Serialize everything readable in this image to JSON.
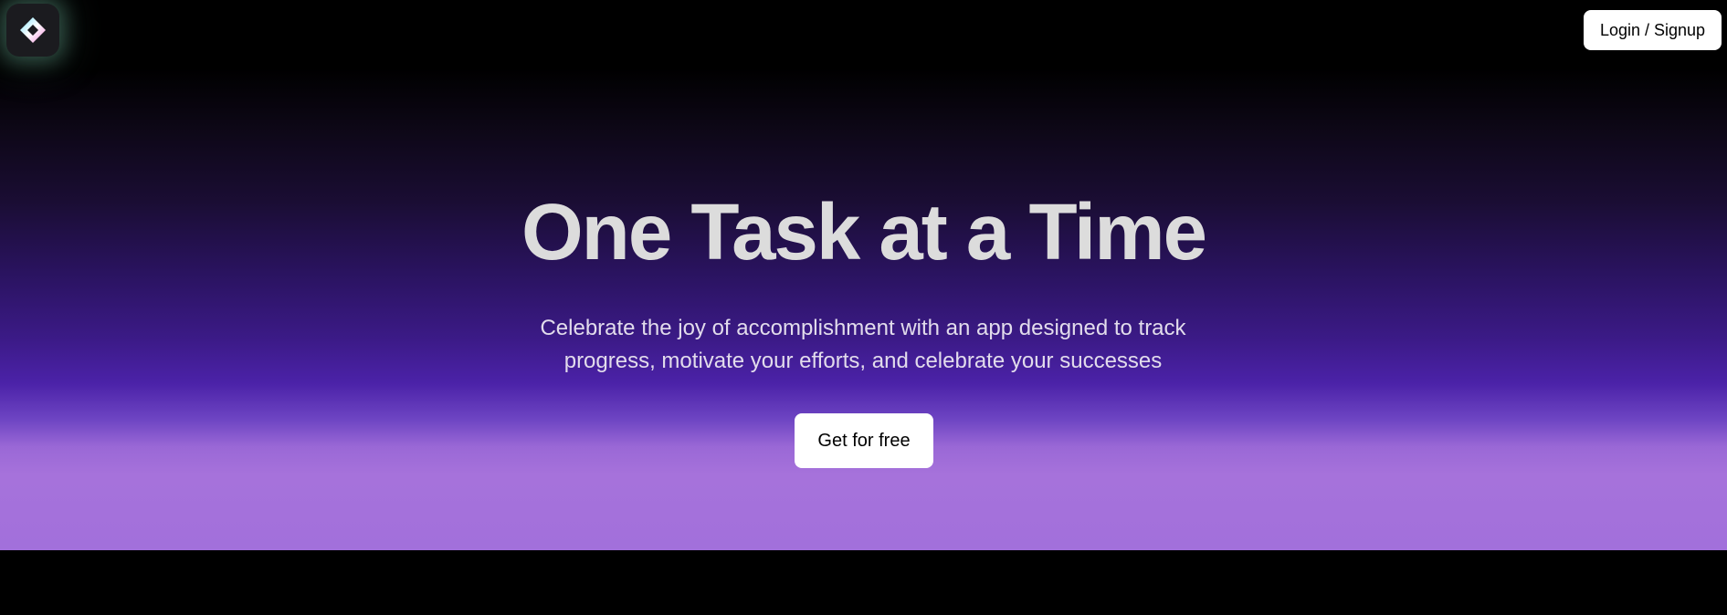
{
  "header": {
    "logo_icon": "diamond-logo-icon",
    "login_label": "Login / Signup"
  },
  "hero": {
    "title": "One Task at a Time",
    "subtitle": "Celebrate the joy of accomplishment with an app designed to track progress, motivate your efforts, and celebrate your successes",
    "cta_label": "Get for free"
  },
  "colors": {
    "background": "#000000",
    "gradient_mid": "#4b22a8",
    "gradient_bottom": "#a270db",
    "button_bg": "#ffffff",
    "title_text": "#dcdcdc"
  }
}
